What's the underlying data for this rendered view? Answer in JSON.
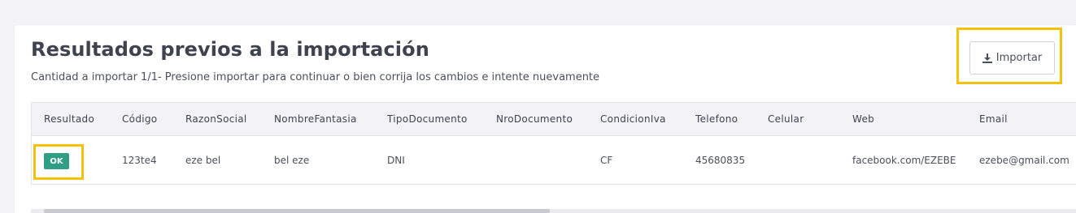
{
  "header": {
    "title": "Resultados previos a la importación",
    "subtitle": "Cantidad a importar 1/1- Presione importar para continuar o bien corrija los cambios e intente nuevamente"
  },
  "toolbar": {
    "import_label": "Importar",
    "import_icon": "download-icon"
  },
  "table": {
    "columns": [
      "Resultado",
      "Código",
      "RazonSocial",
      "NombreFantasia",
      "TipoDocumento",
      "NroDocumento",
      "CondicionIva",
      "Telefono",
      "Celular",
      "Web",
      "Email"
    ],
    "rows": [
      {
        "status": "OK",
        "cells": [
          "123te4",
          "eze bel",
          "bel eze",
          "DNI",
          "",
          "CF",
          "45680835",
          "",
          "facebook.com/EZEBE",
          "ezebe@gmail.com"
        ]
      }
    ]
  },
  "colors": {
    "highlight": "#f4c20d",
    "ok_badge": "#2e9e84",
    "page_bg": "#f3f3f7"
  }
}
